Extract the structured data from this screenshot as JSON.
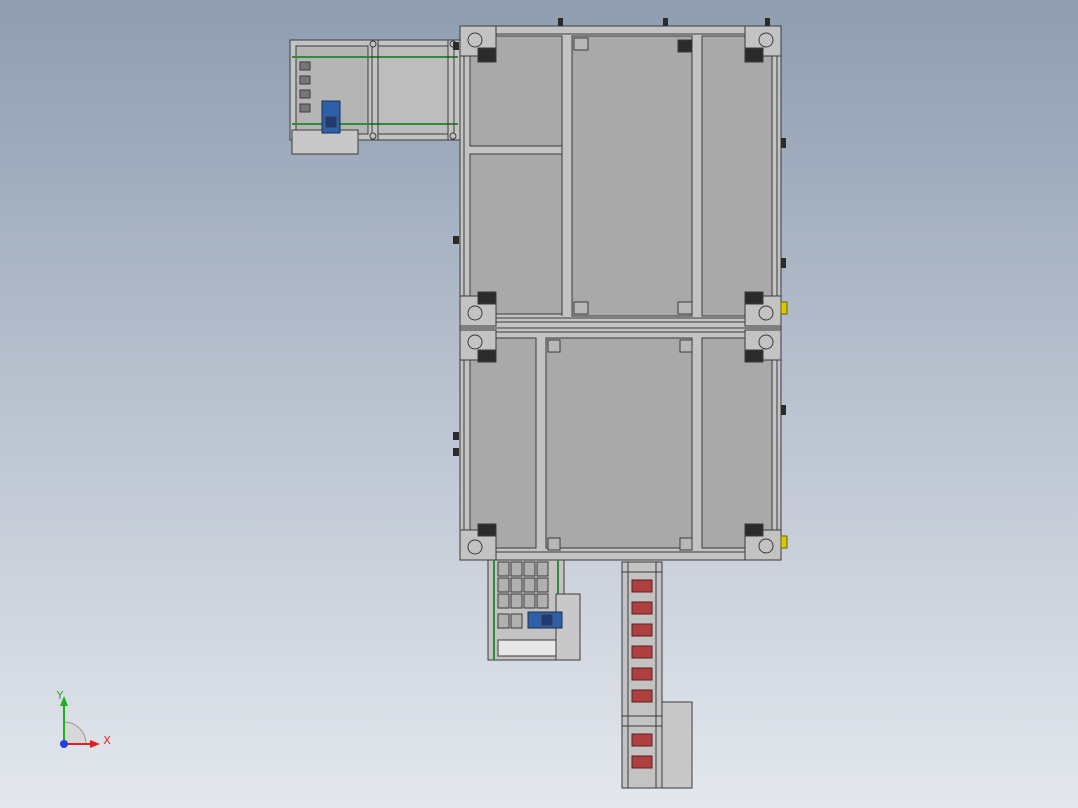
{
  "viewport": {
    "background_top": "#8f9db1",
    "background_bottom": "#e4e8ee"
  },
  "colors": {
    "frame": "#c3c3c3",
    "panel": "#a9a9a9",
    "line": "#3b3b3b",
    "rail_green": "#2f8a3a",
    "motor_blue": "#2f5fa8",
    "roller_red": "#b04040",
    "accent_yellow": "#d8c800",
    "block_dark": "#2b2b2b"
  },
  "triad": {
    "x_label": "X",
    "y_label": "Y",
    "x_color": "#e02020",
    "y_color": "#20b020",
    "z_color": "#2040e0"
  }
}
